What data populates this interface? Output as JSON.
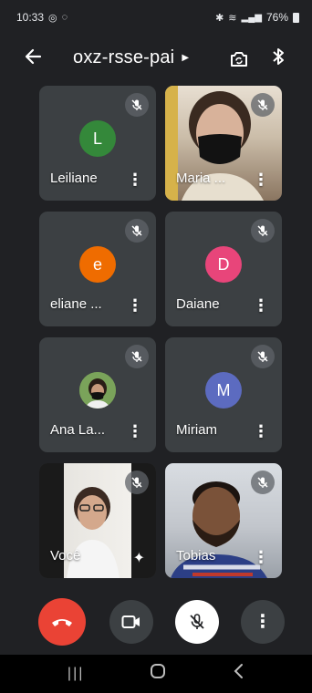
{
  "status": {
    "time": "10:33",
    "battery": "76%"
  },
  "app": {
    "meeting_code": "oxz-rsse-pai"
  },
  "participants": [
    {
      "name": "Leiliane",
      "initial": "L",
      "avatar_color": "#34883a",
      "muted": true
    },
    {
      "name": "Maria ...",
      "initial": "",
      "video": true,
      "muted": true
    },
    {
      "name": "eliane ...",
      "initial": "e",
      "avatar_color": "#ef6c00",
      "muted": true
    },
    {
      "name": "Daiane",
      "initial": "D",
      "avatar_color": "#e8457a",
      "muted": true
    },
    {
      "name": "Ana La...",
      "initial": "",
      "photo_avatar": true,
      "muted": true
    },
    {
      "name": "Miriam",
      "initial": "M",
      "avatar_color": "#5c6bc0",
      "muted": true
    },
    {
      "name": "Você",
      "initial": "",
      "video": true,
      "self": true,
      "muted": true
    },
    {
      "name": "Tobias",
      "initial": "",
      "video": true,
      "muted": true
    }
  ],
  "colors": {
    "background": "#202124",
    "tile": "#3c4043",
    "end_call": "#ea4335",
    "control": "#3c4043",
    "mic_button": "#ffffff"
  },
  "icons": {
    "back": "arrow-left-icon",
    "switch_camera": "camera-switch-icon",
    "bluetooth": "bluetooth-icon",
    "mute": "mic-off-icon",
    "end_call": "phone-hangup-icon",
    "video": "video-camera-icon",
    "mic": "mic-off-icon",
    "more": "more-vert-icon",
    "effects": "sparkle-icon"
  }
}
